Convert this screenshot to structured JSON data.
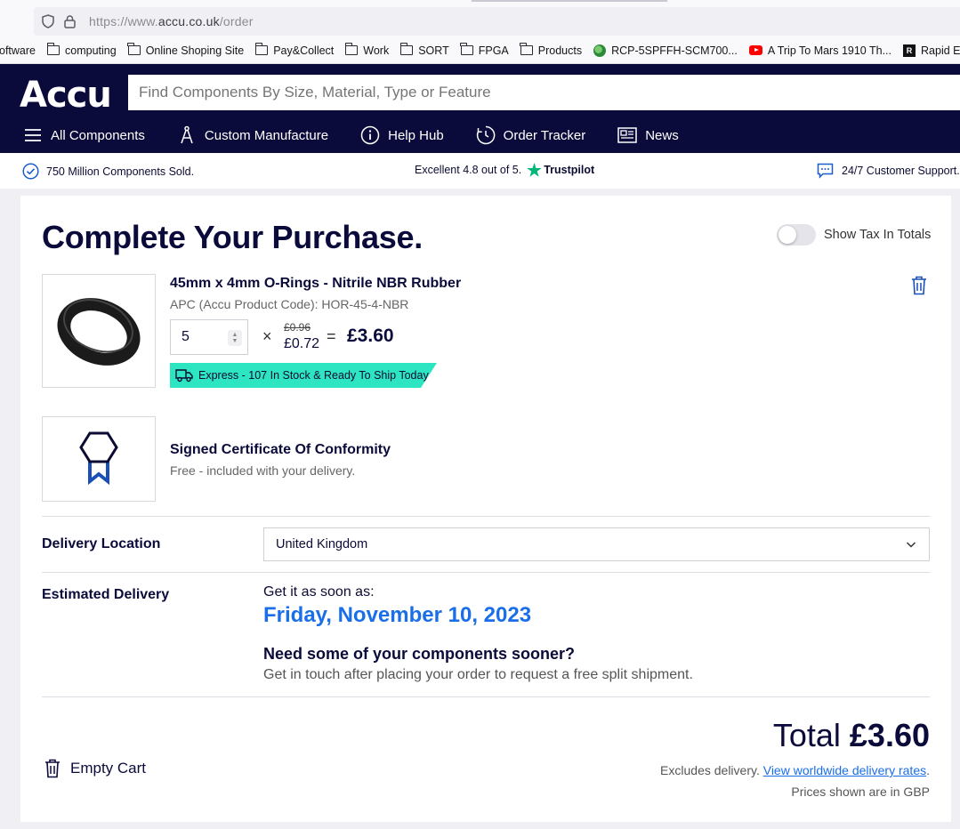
{
  "browser": {
    "url_scheme": "https://www.",
    "url_host": "accu.co.uk",
    "url_path": "/order",
    "bookmarks": [
      {
        "label": "oftware",
        "icon": "none"
      },
      {
        "label": "computing",
        "icon": "folder-icon"
      },
      {
        "label": "Online Shoping Site",
        "icon": "folder-icon"
      },
      {
        "label": "Pay&Collect",
        "icon": "folder-icon"
      },
      {
        "label": "Work",
        "icon": "folder-icon"
      },
      {
        "label": "SORT",
        "icon": "folder-icon"
      },
      {
        "label": "FPGA",
        "icon": "folder-icon"
      },
      {
        "label": "Products",
        "icon": "folder-icon"
      },
      {
        "label": "RCP-5SPFFH-SCM700...",
        "icon": "site-favicon-icon"
      },
      {
        "label": "A Trip To Mars 1910 Th...",
        "icon": "youtube-icon"
      },
      {
        "label": "Rapid Extra Flexible W",
        "icon": "rapid-favicon-icon"
      }
    ]
  },
  "header": {
    "logo": "Accu",
    "search_placeholder": "Find Components By Size, Material, Type or Feature",
    "nav": [
      {
        "label": "All Components",
        "icon": "hamburger-icon"
      },
      {
        "label": "Custom Manufacture",
        "icon": "compass-icon"
      },
      {
        "label": "Help Hub",
        "icon": "info-icon"
      },
      {
        "label": "Order Tracker",
        "icon": "clock-icon"
      },
      {
        "label": "News",
        "icon": "news-icon"
      }
    ]
  },
  "trust_bar": {
    "sold": "750 Million Components Sold.",
    "rating": "Excellent 4.8 out of 5.",
    "trustpilot": "Trustpilot",
    "support": "24/7 Customer Support."
  },
  "order": {
    "title": "Complete Your Purchase.",
    "tax_toggle_label": "Show Tax In Totals",
    "tax_toggle_on": false,
    "item": {
      "name": "45mm x 4mm O-Rings - Nitrile NBR Rubber",
      "code": "APC (Accu Product Code): HOR-45-4-NBR",
      "quantity": "5",
      "times": "×",
      "old_price": "£0.96",
      "unit_price": "£0.72",
      "equals": "=",
      "line_total": "£3.60",
      "stock": "Express - 107 In Stock & Ready To Ship Today"
    },
    "certificate": {
      "title": "Signed Certificate Of Conformity",
      "subtitle": "Free - included with your delivery."
    },
    "delivery": {
      "location_label": "Delivery Location",
      "location_value": "United Kingdom",
      "estimate_label": "Estimated Delivery",
      "soon_text": "Get it as soon as:",
      "date": "Friday, November 10, 2023",
      "sooner_title": "Need some of your components sooner?",
      "sooner_text": "Get in touch after placing your order to request a free split shipment."
    },
    "empty_cart": "Empty Cart",
    "total_label": "Total",
    "total_value": "£3.60",
    "excludes": "Excludes delivery.",
    "rates_link": "View worldwide delivery rates",
    "rates_suffix": ".",
    "currency_note": "Prices shown are in GBP"
  },
  "colors": {
    "brand_navy": "#0b0b3b",
    "accent_blue": "#1a6ee8",
    "stock_green": "#2ee5c1",
    "trustpilot_green": "#00b67a"
  }
}
